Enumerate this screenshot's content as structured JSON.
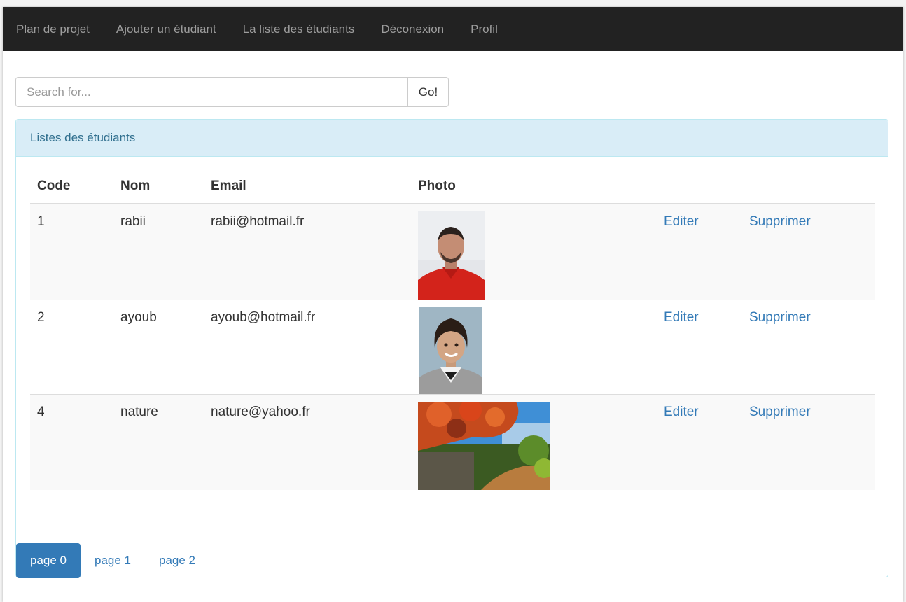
{
  "navbar": {
    "items": [
      "Plan de projet",
      "Ajouter un étudiant",
      "La liste des étudiants",
      "Déconexion",
      "Profil"
    ]
  },
  "search": {
    "placeholder": "Search for...",
    "button_label": "Go!"
  },
  "panel": {
    "title": "Listes des étudiants"
  },
  "table": {
    "headers": [
      "Code",
      "Nom",
      "Email",
      "Photo"
    ],
    "rows": [
      {
        "code": "1",
        "nom": "rabii",
        "email": "rabii@hotmail.fr",
        "photo": "portrait-man-red-shirt",
        "edit": "Editer",
        "delete": "Supprimer"
      },
      {
        "code": "2",
        "nom": "ayoub",
        "email": "ayoub@hotmail.fr",
        "photo": "portrait-child",
        "edit": "Editer",
        "delete": "Supprimer"
      },
      {
        "code": "4",
        "nom": "nature",
        "email": "nature@yahoo.fr",
        "photo": "landscape-flowering-tree",
        "edit": "Editer",
        "delete": "Supprimer"
      }
    ]
  },
  "pagination": {
    "pages": [
      "page 0",
      "page 1",
      "page 2"
    ],
    "active_index": 0
  },
  "colors": {
    "navbar_bg": "#222222",
    "link": "#337ab7",
    "panel_heading_bg": "#d9edf7",
    "panel_heading_text": "#31708f"
  }
}
